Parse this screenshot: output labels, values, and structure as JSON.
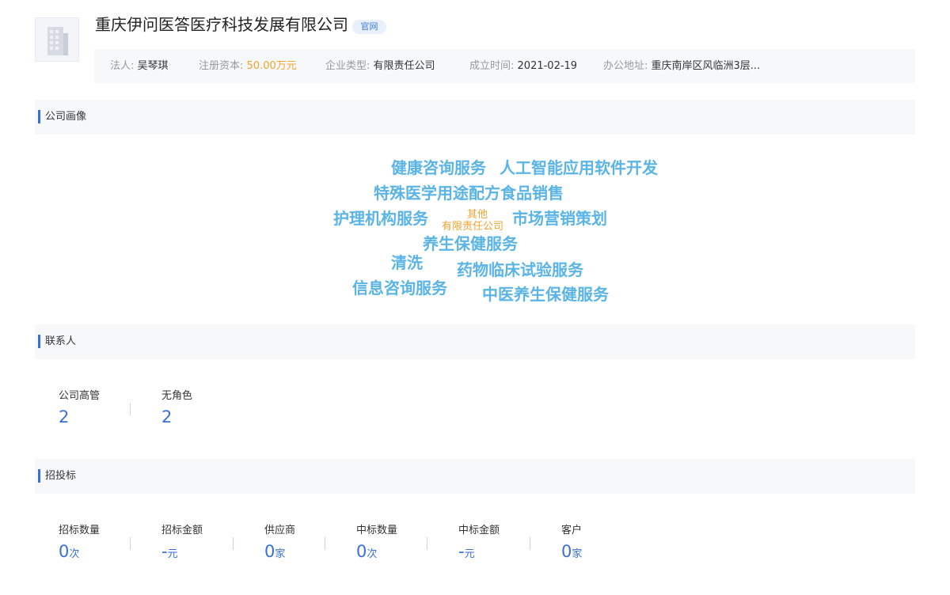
{
  "company": {
    "name": "重庆伊问医答医疗科技发展有限公司",
    "official_badge": "官网"
  },
  "info": {
    "legal_label": "法人:",
    "legal_value": "吴琴琪",
    "capital_label": "注册资本:",
    "capital_value": "50.00万元",
    "type_label": "企业类型:",
    "type_value": "有限责任公司",
    "founded_label": "成立时间:",
    "founded_value": "2021-02-19",
    "address_label": "办公地址:",
    "address_value": "重庆南岸区风临洲3层..."
  },
  "portrait": {
    "title": "公司画像",
    "words": [
      "健康咨询服务",
      "人工智能应用软件开发",
      "特殊医学用途配方食品销售",
      "护理机构服务",
      "其他",
      "有限责任公司",
      "市场营销策划",
      "养生保健服务",
      "清洗",
      "药物临床试验服务",
      "信息咨询服务",
      "中医养生保健服务"
    ]
  },
  "contacts": {
    "title": "联系人",
    "stats": [
      {
        "label": "公司高管",
        "value": "2"
      },
      {
        "label": "无角色",
        "value": "2"
      }
    ]
  },
  "bidding": {
    "title": "招投标",
    "stats": [
      {
        "label": "招标数量",
        "value": "0",
        "unit": "次"
      },
      {
        "label": "招标金额",
        "value": "-",
        "unit": "元"
      },
      {
        "label": "供应商",
        "value": "0",
        "unit": "家"
      },
      {
        "label": "中标数量",
        "value": "0",
        "unit": "次"
      },
      {
        "label": "中标金额",
        "value": "-",
        "unit": "元"
      },
      {
        "label": "客户",
        "value": "0",
        "unit": "家"
      }
    ]
  },
  "colors": {
    "accent_blue": "#3a6fd8",
    "cloud_blue": "#5ab4e6",
    "highlight_orange": "#f2a32c"
  },
  "icons": {
    "logo": "building-icon"
  }
}
